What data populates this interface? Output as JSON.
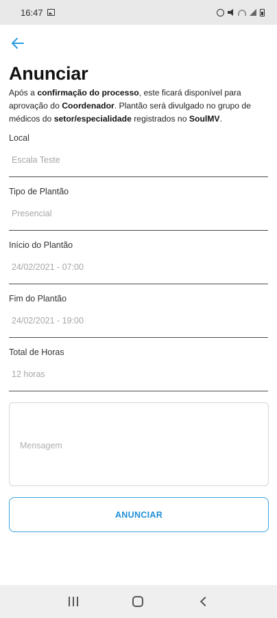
{
  "status_bar": {
    "time": "16:47"
  },
  "header": {
    "title": "Anunciar"
  },
  "description": {
    "part1": "Após a ",
    "bold1": "confirmação do processo",
    "part2": ", este ficará disponível para aprovação do ",
    "bold2": "Coordenador",
    "part3": ". Plantão será divulgado no grupo de médicos do ",
    "bold3": "setor/especialidade",
    "part4": " registrados no ",
    "bold4": "SoulMV",
    "part5": "."
  },
  "fields": [
    {
      "label": "Local",
      "value": "Escala Teste"
    },
    {
      "label": "Tipo de Plantão",
      "value": "Presencial"
    },
    {
      "label": "Início do Plantão",
      "value": "24/02/2021 - 07:00"
    },
    {
      "label": "Fim do Plantão",
      "value": "24/02/2021 - 19:00"
    },
    {
      "label": "Total de Horas",
      "value": "12 horas"
    }
  ],
  "message": {
    "placeholder": "Mensagem"
  },
  "actions": {
    "announce_label": "ANUNCIAR"
  },
  "colors": {
    "accent": "#1f8fd6",
    "button_border": "#3aa3e0",
    "back_arrow": "#2a9ae0"
  },
  "icons": {
    "back": "arrow-left-icon",
    "status": [
      "image-icon",
      "alarm-icon",
      "mute-icon",
      "wifi-icon",
      "signal-icon",
      "battery-icon"
    ],
    "nav": [
      "recent-apps-icon",
      "home-icon",
      "back-icon"
    ]
  }
}
